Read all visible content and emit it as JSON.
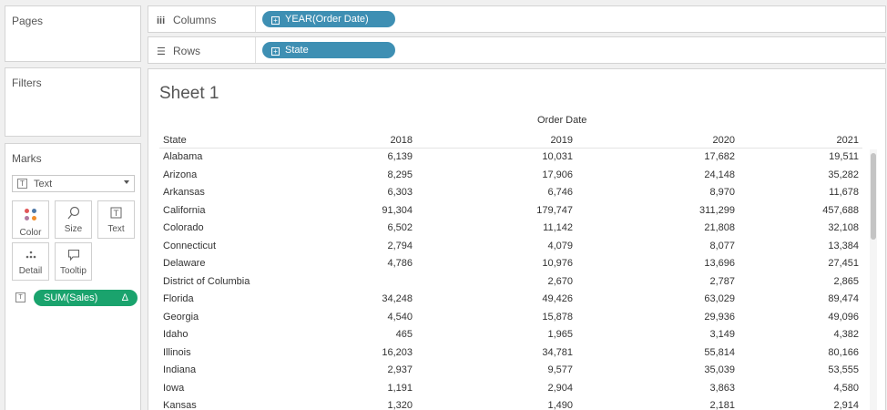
{
  "panels": {
    "pages": "Pages",
    "filters": "Filters",
    "marks": "Marks"
  },
  "marks": {
    "mark_type": "Text",
    "buttons": [
      {
        "label": "Color",
        "icon": "color-dots-icon"
      },
      {
        "label": "Size",
        "icon": "size-icon"
      },
      {
        "label": "Text",
        "icon": "text-icon"
      },
      {
        "label": "Detail",
        "icon": "detail-icon"
      },
      {
        "label": "Tooltip",
        "icon": "tooltip-icon"
      }
    ],
    "field_pill": "SUM(Sales)",
    "pill_color": "#1aa36d"
  },
  "shelves": {
    "columns_label": "Columns",
    "columns_pill": "YEAR(Order Date)",
    "rows_label": "Rows",
    "rows_pill": "State",
    "pill_color": "#3e8fb3"
  },
  "sheet": {
    "title": "Sheet 1",
    "column_field": "Order Date",
    "row_header": "State",
    "years": [
      "2018",
      "2019",
      "2020",
      "2021"
    ],
    "rows": [
      {
        "state": "Alabama",
        "values": [
          "6,139",
          "10,031",
          "17,682",
          "19,511"
        ]
      },
      {
        "state": "Arizona",
        "values": [
          "8,295",
          "17,906",
          "24,148",
          "35,282"
        ]
      },
      {
        "state": "Arkansas",
        "values": [
          "6,303",
          "6,746",
          "8,970",
          "11,678"
        ]
      },
      {
        "state": "California",
        "values": [
          "91,304",
          "179,747",
          "311,299",
          "457,688"
        ]
      },
      {
        "state": "Colorado",
        "values": [
          "6,502",
          "11,142",
          "21,808",
          "32,108"
        ]
      },
      {
        "state": "Connecticut",
        "values": [
          "2,794",
          "4,079",
          "8,077",
          "13,384"
        ]
      },
      {
        "state": "Delaware",
        "values": [
          "4,786",
          "10,976",
          "13,696",
          "27,451"
        ]
      },
      {
        "state": "District of Columbia",
        "values": [
          "",
          "2,670",
          "2,787",
          "2,865"
        ]
      },
      {
        "state": "Florida",
        "values": [
          "34,248",
          "49,426",
          "63,029",
          "89,474"
        ]
      },
      {
        "state": "Georgia",
        "values": [
          "4,540",
          "15,878",
          "29,936",
          "49,096"
        ]
      },
      {
        "state": "Idaho",
        "values": [
          "465",
          "1,965",
          "3,149",
          "4,382"
        ]
      },
      {
        "state": "Illinois",
        "values": [
          "16,203",
          "34,781",
          "55,814",
          "80,166"
        ]
      },
      {
        "state": "Indiana",
        "values": [
          "2,937",
          "9,577",
          "35,039",
          "53,555"
        ]
      },
      {
        "state": "Iowa",
        "values": [
          "1,191",
          "2,904",
          "3,863",
          "4,580"
        ]
      },
      {
        "state": "Kansas",
        "values": [
          "1,320",
          "1,490",
          "2,181",
          "2,914"
        ]
      }
    ]
  }
}
